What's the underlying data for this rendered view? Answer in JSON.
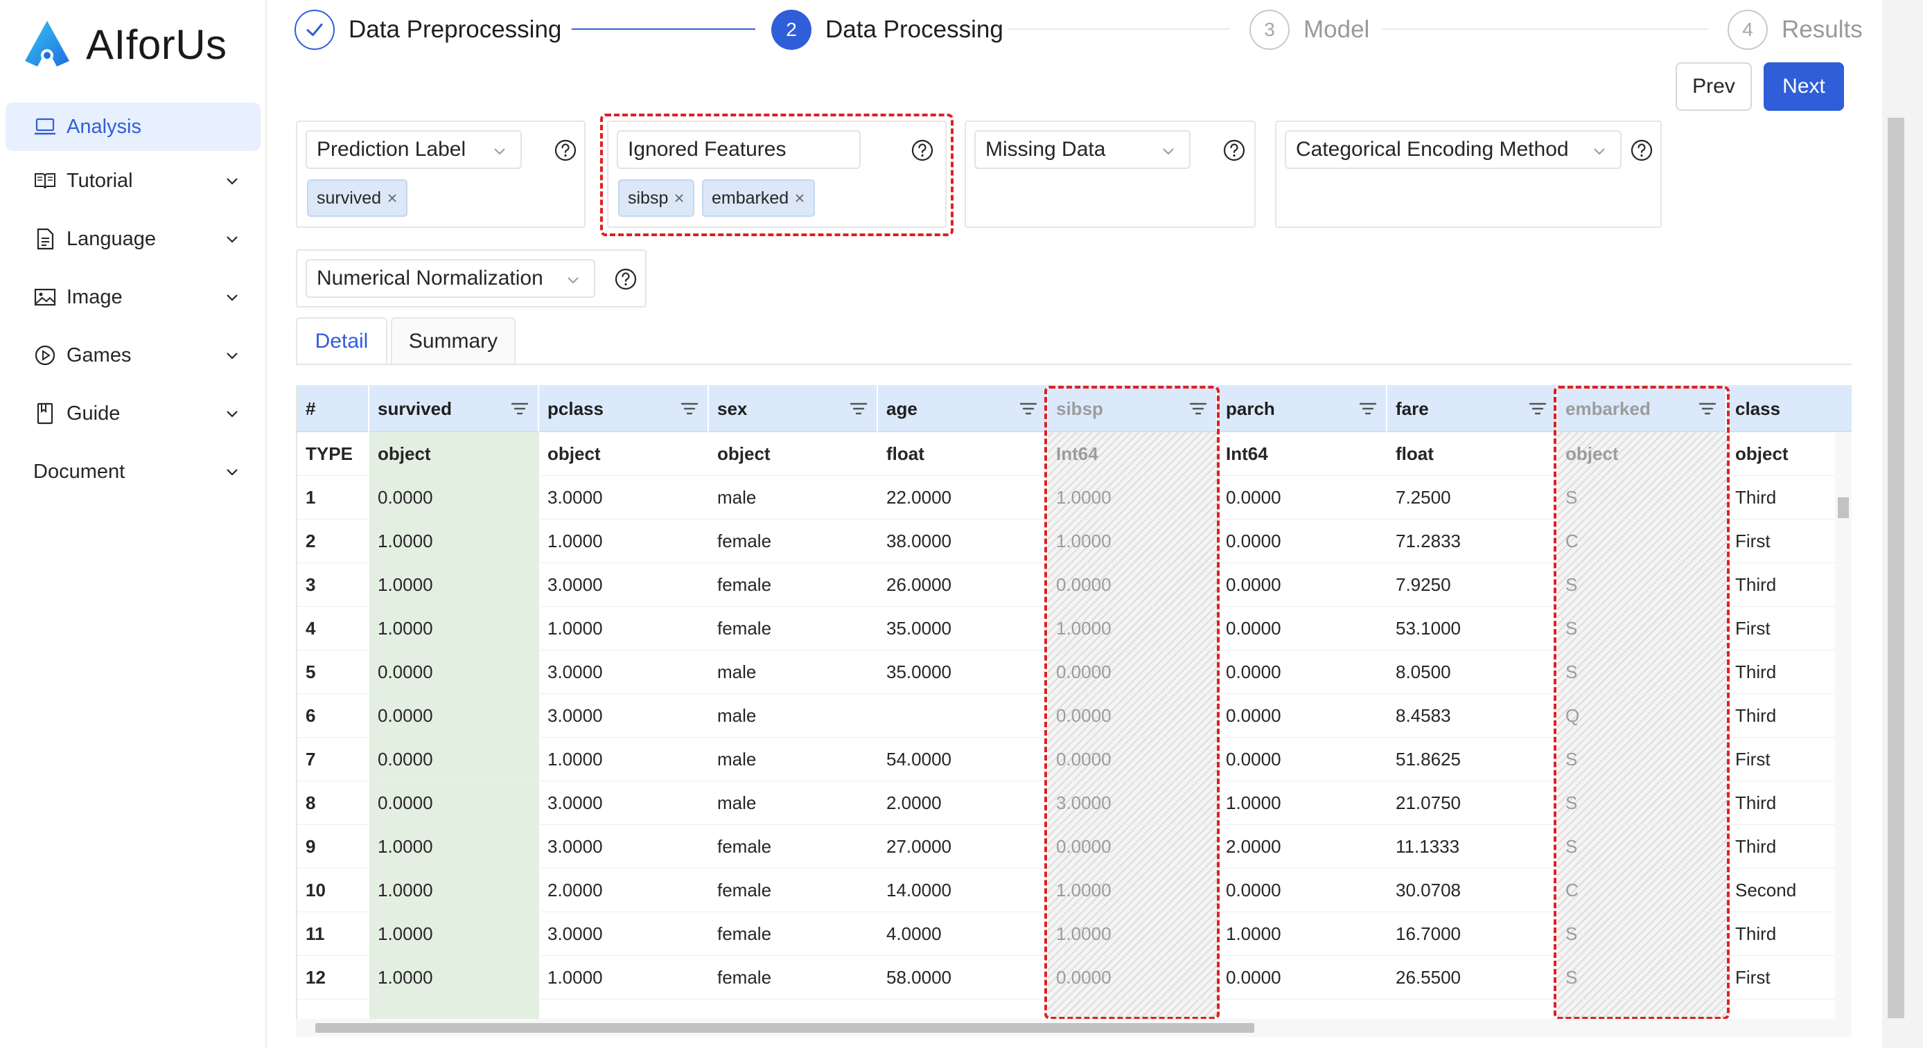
{
  "app": {
    "name": "AIforUs"
  },
  "sidebar": {
    "items": [
      {
        "label": "Analysis",
        "icon": "laptop-icon",
        "active": true,
        "expandable": false
      },
      {
        "label": "Tutorial",
        "icon": "book-icon",
        "active": false,
        "expandable": true
      },
      {
        "label": "Language",
        "icon": "file-text-icon",
        "active": false,
        "expandable": true
      },
      {
        "label": "Image",
        "icon": "picture-icon",
        "active": false,
        "expandable": true
      },
      {
        "label": "Games",
        "icon": "play-circle-icon",
        "active": false,
        "expandable": true
      },
      {
        "label": "Guide",
        "icon": "bookmark-icon",
        "active": false,
        "expandable": true
      },
      {
        "label": "Document",
        "icon": "",
        "active": false,
        "expandable": true
      }
    ]
  },
  "stepper": {
    "steps": [
      {
        "num": "1",
        "label": "Data Preprocessing",
        "status": "done"
      },
      {
        "num": "2",
        "label": "Data Processing",
        "status": "active"
      },
      {
        "num": "3",
        "label": "Model",
        "status": "wait"
      },
      {
        "num": "4",
        "label": "Results",
        "status": "wait"
      }
    ]
  },
  "buttons": {
    "prev": "Prev",
    "next": "Next"
  },
  "options": {
    "prediction_label": {
      "placeholder": "Prediction Label",
      "tags": [
        "survived"
      ]
    },
    "ignored_features": {
      "placeholder": "Ignored Features",
      "tags": [
        "sibsp",
        "embarked"
      ]
    },
    "missing_data": {
      "placeholder": "Missing Data"
    },
    "categorical_encoding": {
      "placeholder": "Categorical Encoding Method"
    },
    "numerical_normalization": {
      "placeholder": "Numerical Normalization"
    }
  },
  "tabs": {
    "detail": "Detail",
    "summary": "Summary",
    "active": "Detail"
  },
  "table": {
    "columns": [
      "#",
      "survived",
      "pclass",
      "sex",
      "age",
      "sibsp",
      "parch",
      "fare",
      "embarked",
      "class"
    ],
    "types": [
      "TYPE",
      "object",
      "object",
      "object",
      "float",
      "Int64",
      "Int64",
      "float",
      "object",
      "object"
    ],
    "rows": [
      [
        "1",
        "0.0000",
        "3.0000",
        "male",
        "22.0000",
        "1.0000",
        "0.0000",
        "7.2500",
        "S",
        "Third"
      ],
      [
        "2",
        "1.0000",
        "1.0000",
        "female",
        "38.0000",
        "1.0000",
        "0.0000",
        "71.2833",
        "C",
        "First"
      ],
      [
        "3",
        "1.0000",
        "3.0000",
        "female",
        "26.0000",
        "0.0000",
        "0.0000",
        "7.9250",
        "S",
        "Third"
      ],
      [
        "4",
        "1.0000",
        "1.0000",
        "female",
        "35.0000",
        "1.0000",
        "0.0000",
        "53.1000",
        "S",
        "First"
      ],
      [
        "5",
        "0.0000",
        "3.0000",
        "male",
        "35.0000",
        "0.0000",
        "0.0000",
        "8.0500",
        "S",
        "Third"
      ],
      [
        "6",
        "0.0000",
        "3.0000",
        "male",
        "",
        "0.0000",
        "0.0000",
        "8.4583",
        "Q",
        "Third"
      ],
      [
        "7",
        "0.0000",
        "1.0000",
        "male",
        "54.0000",
        "0.0000",
        "0.0000",
        "51.8625",
        "S",
        "First"
      ],
      [
        "8",
        "0.0000",
        "3.0000",
        "male",
        "2.0000",
        "3.0000",
        "1.0000",
        "21.0750",
        "S",
        "Third"
      ],
      [
        "9",
        "1.0000",
        "3.0000",
        "female",
        "27.0000",
        "0.0000",
        "2.0000",
        "11.1333",
        "S",
        "Third"
      ],
      [
        "10",
        "1.0000",
        "2.0000",
        "female",
        "14.0000",
        "1.0000",
        "0.0000",
        "30.0708",
        "C",
        "Second"
      ],
      [
        "11",
        "1.0000",
        "3.0000",
        "female",
        "4.0000",
        "1.0000",
        "1.0000",
        "16.7000",
        "S",
        "Third"
      ],
      [
        "12",
        "1.0000",
        "1.0000",
        "female",
        "58.0000",
        "0.0000",
        "0.0000",
        "26.5500",
        "S",
        "First"
      ]
    ],
    "label_column": "survived",
    "ignored_columns": [
      "sibsp",
      "embarked"
    ]
  },
  "colors": {
    "primary": "#2f5ed8",
    "label_column_bg": "#e3efe1",
    "header_bg": "#dbe9fb",
    "highlight_dash": "#e02020"
  }
}
